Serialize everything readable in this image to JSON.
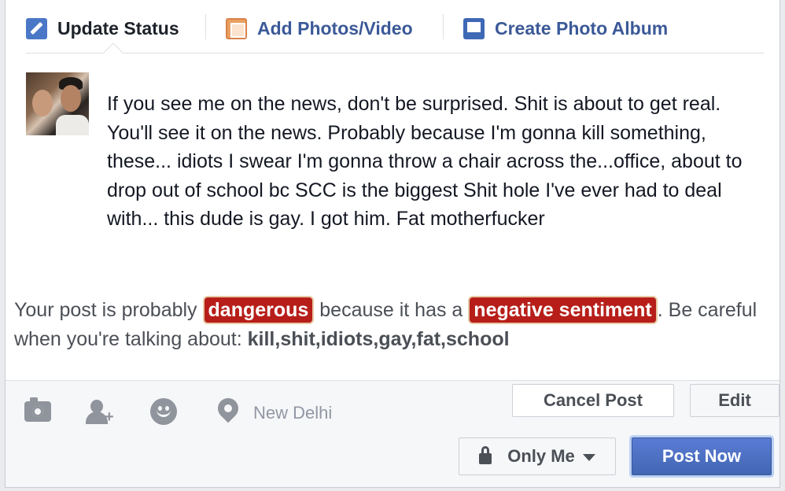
{
  "tabs": {
    "update_status": "Update Status",
    "add_photos": "Add Photos/Video",
    "create_album": "Create Photo Album"
  },
  "post": {
    "text": "If you see me on the news, don't be surprised. Shit is about to get real. You'll see it on the news. Probably because I'm gonna kill something, these... idiots I swear I'm gonna throw a chair across the...office, about to drop out of school bc SCC is the biggest Shit hole I've ever had to deal with... this dude is gay. I got him. Fat motherfucker"
  },
  "warning": {
    "prefix": "Your post is probably",
    "danger_label": "dangerous",
    "middle": "because it has a",
    "sentiment_label": "negative sentiment",
    "suffix": ". Be careful when you're talking about:",
    "keywords": "kill,shit,idiots,gay,fat,school",
    "highlight_color": "#b71e19"
  },
  "footer": {
    "icons": [
      "camera-icon",
      "tag-friends-icon",
      "emoji-icon",
      "location-pin-icon"
    ],
    "location": "New Delhi",
    "cancel_label": "Cancel Post",
    "edit_label": "Edit",
    "privacy_label": "Only Me",
    "post_label": "Post Now",
    "accent": "#4267b2"
  }
}
